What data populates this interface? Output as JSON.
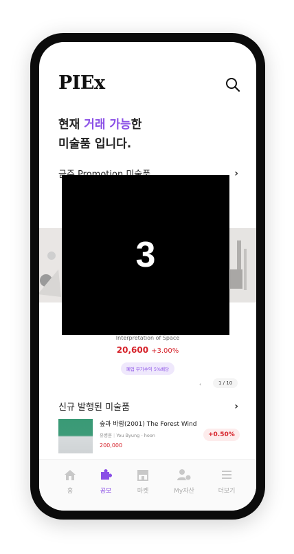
{
  "header": {
    "logo": "PIEx",
    "search_icon": "search-icon"
  },
  "headline": {
    "line1_prefix": "현재 ",
    "line1_accent": "거래 가능",
    "line1_suffix": "한",
    "line2": "미술품 입니다."
  },
  "promotion": {
    "section_title": "금주 Promotion 미술품",
    "overlay_number": "3",
    "title": "Interpretation of Space",
    "price": "20,600",
    "rate": "+3.00%",
    "badge": "폐업 부가수익 5%배당",
    "pager_prev": "‹",
    "pager": "1 / 10"
  },
  "new_section": {
    "title": "신규 발행된 미술품",
    "items": [
      {
        "title": "숲과 바람(2001)  The Forest Wind",
        "artist_kr": "유병훈",
        "artist_en": "You Byung - hoon",
        "price": "200,000",
        "rate": "+0.50%"
      }
    ]
  },
  "tabs": [
    {
      "label": "홈",
      "icon": "home-icon",
      "active": false
    },
    {
      "label": "공모",
      "icon": "puzzle-icon",
      "active": true
    },
    {
      "label": "마켓",
      "icon": "store-icon",
      "active": false
    },
    {
      "label": "My자산",
      "icon": "user-coin-icon",
      "active": false
    },
    {
      "label": "더보기",
      "icon": "menu-icon",
      "active": false
    }
  ],
  "colors": {
    "accent": "#8a4fe6",
    "price_red": "#d6222a",
    "frame": "#0b0b0b"
  }
}
